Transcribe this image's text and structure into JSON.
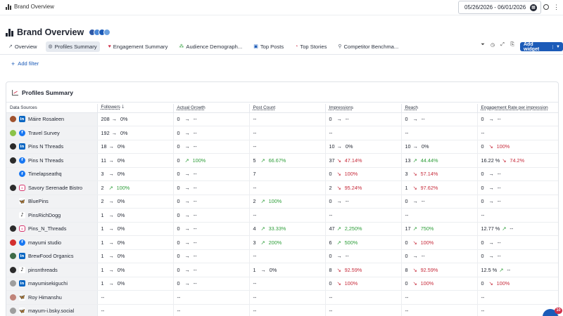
{
  "app": {
    "breadcrumb": "Brand Overview",
    "date_range": "05/26/2026 - 06/01/2026",
    "page_title": "Brand Overview"
  },
  "tabs": [
    {
      "label": "Overview",
      "icon": "trend-icon",
      "active": false
    },
    {
      "label": "Profiles Summary",
      "icon": "profile-icon",
      "active": true
    },
    {
      "label": "Engagement Summary",
      "icon": "heart-icon",
      "active": false
    },
    {
      "label": "Audience Demograph...",
      "icon": "audience-icon",
      "active": false
    },
    {
      "label": "Top Posts",
      "icon": "posts-icon",
      "active": false
    },
    {
      "label": "Top Stories",
      "icon": "stories-icon",
      "active": false
    },
    {
      "label": "Competitor Benchma...",
      "icon": "competitor-icon",
      "active": false
    }
  ],
  "toolbar": {
    "add_widget": "Add widget"
  },
  "filter": {
    "add_filter": "Add filter"
  },
  "panel": {
    "title": "Profiles Summary"
  },
  "columns": [
    "Data Sources",
    "Followers",
    "Actual Growth",
    "Post Count",
    "Impressions",
    "Reach",
    "Engagement Rate per impression"
  ],
  "colors": {
    "accent": "#1c5bb8",
    "up": "#2e9e3a",
    "down": "#c62a3a",
    "row_label_bg": "#f1f2f4"
  },
  "rows": [
    {
      "name": "Máire Rosaleen",
      "network": "linkedin",
      "avatar": "#a0522d",
      "cells": [
        {
          "v": "208",
          "d": "flat",
          "p": "0%"
        },
        {
          "v": "0",
          "d": "flat",
          "p": "--"
        },
        {
          "v": "--",
          "d": "",
          "p": ""
        },
        {
          "v": "0",
          "d": "flat",
          "p": "--"
        },
        {
          "v": "0",
          "d": "flat",
          "p": "--"
        },
        {
          "v": "0",
          "d": "flat",
          "p": "--"
        }
      ]
    },
    {
      "name": "Travel Survey",
      "network": "facebook",
      "avatar": "#8bc34a",
      "cells": [
        {
          "v": "192",
          "d": "flat",
          "p": "0%"
        },
        {
          "v": "0",
          "d": "flat",
          "p": "--"
        },
        {
          "v": "--",
          "d": "",
          "p": ""
        },
        {
          "v": "--",
          "d": "",
          "p": ""
        },
        {
          "v": "--",
          "d": "",
          "p": ""
        },
        {
          "v": "--",
          "d": "",
          "p": ""
        }
      ]
    },
    {
      "name": "Pins N Threads",
      "network": "linkedin",
      "avatar": "#2b2b2b",
      "cells": [
        {
          "v": "18",
          "d": "flat",
          "p": "0%"
        },
        {
          "v": "0",
          "d": "flat",
          "p": "--"
        },
        {
          "v": "--",
          "d": "",
          "p": ""
        },
        {
          "v": "10",
          "d": "flat",
          "p": "0%"
        },
        {
          "v": "10",
          "d": "flat",
          "p": "0%"
        },
        {
          "v": "0",
          "d": "down",
          "p": "100%"
        }
      ]
    },
    {
      "name": "Pins N Threads",
      "network": "facebook",
      "avatar": "#2b2b2b",
      "cells": [
        {
          "v": "11",
          "d": "flat",
          "p": "0%"
        },
        {
          "v": "0",
          "d": "up",
          "p": "100%"
        },
        {
          "v": "5",
          "d": "up",
          "p": "66.67%"
        },
        {
          "v": "37",
          "d": "down",
          "p": "47.14%"
        },
        {
          "v": "13",
          "d": "up",
          "p": "44.44%"
        },
        {
          "v": "16.22  %",
          "d": "down",
          "p": "74.2%"
        }
      ]
    },
    {
      "name": "Timelapseathq",
      "network": "facebook",
      "avatar": "",
      "cells": [
        {
          "v": "3",
          "d": "flat",
          "p": "0%"
        },
        {
          "v": "0",
          "d": "flat",
          "p": "--"
        },
        {
          "v": "7",
          "d": "",
          "p": ""
        },
        {
          "v": "0",
          "d": "down",
          "p": "100%"
        },
        {
          "v": "3",
          "d": "down",
          "p": "57.14%"
        },
        {
          "v": "0",
          "d": "flat",
          "p": "--"
        }
      ]
    },
    {
      "name": "Savory Serenade Bistro",
      "network": "instagram",
      "avatar": "#2b2b2b",
      "cells": [
        {
          "v": "2",
          "d": "up",
          "p": "100%"
        },
        {
          "v": "0",
          "d": "flat",
          "p": "--"
        },
        {
          "v": "--",
          "d": "",
          "p": ""
        },
        {
          "v": "2",
          "d": "down",
          "p": "95.24%"
        },
        {
          "v": "1",
          "d": "down",
          "p": "97.62%"
        },
        {
          "v": "0",
          "d": "flat",
          "p": "--"
        }
      ]
    },
    {
      "name": "BluePins",
      "network": "bluesky",
      "avatar": "",
      "cells": [
        {
          "v": "2",
          "d": "flat",
          "p": "0%"
        },
        {
          "v": "0",
          "d": "flat",
          "p": "--"
        },
        {
          "v": "2",
          "d": "up",
          "p": "100%"
        },
        {
          "v": "0",
          "d": "flat",
          "p": "--"
        },
        {
          "v": "0",
          "d": "flat",
          "p": "--"
        },
        {
          "v": "0",
          "d": "flat",
          "p": "--"
        }
      ]
    },
    {
      "name": "PinsRichDogg",
      "network": "tiktok",
      "avatar": "",
      "cells": [
        {
          "v": "1",
          "d": "flat",
          "p": "0%"
        },
        {
          "v": "0",
          "d": "flat",
          "p": "--"
        },
        {
          "v": "--",
          "d": "",
          "p": ""
        },
        {
          "v": "--",
          "d": "",
          "p": ""
        },
        {
          "v": "--",
          "d": "",
          "p": ""
        },
        {
          "v": "--",
          "d": "",
          "p": ""
        }
      ]
    },
    {
      "name": "Pins_N_Threads",
      "network": "instagram",
      "avatar": "#2b2b2b",
      "cells": [
        {
          "v": "1",
          "d": "flat",
          "p": "0%"
        },
        {
          "v": "0",
          "d": "flat",
          "p": "--"
        },
        {
          "v": "4",
          "d": "up",
          "p": "33.33%"
        },
        {
          "v": "47",
          "d": "up",
          "p": "2,250%"
        },
        {
          "v": "17",
          "d": "up",
          "p": "750%"
        },
        {
          "v": "12.77  %",
          "d": "up",
          "p": "--"
        }
      ]
    },
    {
      "name": "mayumi studio",
      "network": "facebook",
      "avatar": "#d32f2f",
      "cells": [
        {
          "v": "1",
          "d": "flat",
          "p": "0%"
        },
        {
          "v": "0",
          "d": "flat",
          "p": "--"
        },
        {
          "v": "3",
          "d": "up",
          "p": "200%"
        },
        {
          "v": "6",
          "d": "up",
          "p": "500%"
        },
        {
          "v": "0",
          "d": "down",
          "p": "100%"
        },
        {
          "v": "0",
          "d": "flat",
          "p": "--"
        }
      ]
    },
    {
      "name": "BrewFood Organics",
      "network": "linkedin",
      "avatar": "#3e6b48",
      "cells": [
        {
          "v": "1",
          "d": "flat",
          "p": "0%"
        },
        {
          "v": "0",
          "d": "flat",
          "p": "--"
        },
        {
          "v": "--",
          "d": "",
          "p": ""
        },
        {
          "v": "0",
          "d": "flat",
          "p": "--"
        },
        {
          "v": "0",
          "d": "flat",
          "p": "--"
        },
        {
          "v": "0",
          "d": "flat",
          "p": "--"
        }
      ]
    },
    {
      "name": "pinsnthreads",
      "network": "tiktok",
      "avatar": "#2b2b2b",
      "cells": [
        {
          "v": "1",
          "d": "flat",
          "p": "0%"
        },
        {
          "v": "0",
          "d": "flat",
          "p": "--"
        },
        {
          "v": "1",
          "d": "flat",
          "p": "0%"
        },
        {
          "v": "8",
          "d": "down",
          "p": "92.59%"
        },
        {
          "v": "8",
          "d": "down",
          "p": "92.59%"
        },
        {
          "v": "12.5  %",
          "d": "up",
          "p": "--"
        }
      ]
    },
    {
      "name": "mayumisekiguchi",
      "network": "linkedin",
      "avatar": "#9e9e9e",
      "cells": [
        {
          "v": "1",
          "d": "flat",
          "p": "0%"
        },
        {
          "v": "0",
          "d": "flat",
          "p": "--"
        },
        {
          "v": "--",
          "d": "",
          "p": ""
        },
        {
          "v": "0",
          "d": "down",
          "p": "100%"
        },
        {
          "v": "0",
          "d": "down",
          "p": "100%"
        },
        {
          "v": "0",
          "d": "down",
          "p": "100%"
        }
      ]
    },
    {
      "name": "Roy Himanshu",
      "network": "bluesky",
      "avatar": "#c0847a",
      "cells": [
        {
          "v": "--",
          "d": "",
          "p": ""
        },
        {
          "v": "--",
          "d": "",
          "p": ""
        },
        {
          "v": "--",
          "d": "",
          "p": ""
        },
        {
          "v": "--",
          "d": "",
          "p": ""
        },
        {
          "v": "--",
          "d": "",
          "p": ""
        },
        {
          "v": "--",
          "d": "",
          "p": ""
        }
      ]
    },
    {
      "name": "mayum-i.bsky.social",
      "network": "bluesky",
      "avatar": "#9e9e9e",
      "cells": [
        {
          "v": "--",
          "d": "",
          "p": ""
        },
        {
          "v": "--",
          "d": "",
          "p": ""
        },
        {
          "v": "--",
          "d": "",
          "p": ""
        },
        {
          "v": "--",
          "d": "",
          "p": ""
        },
        {
          "v": "--",
          "d": "",
          "p": ""
        },
        {
          "v": "--",
          "d": "",
          "p": ""
        }
      ]
    }
  ],
  "chat": {
    "badge": "10"
  }
}
